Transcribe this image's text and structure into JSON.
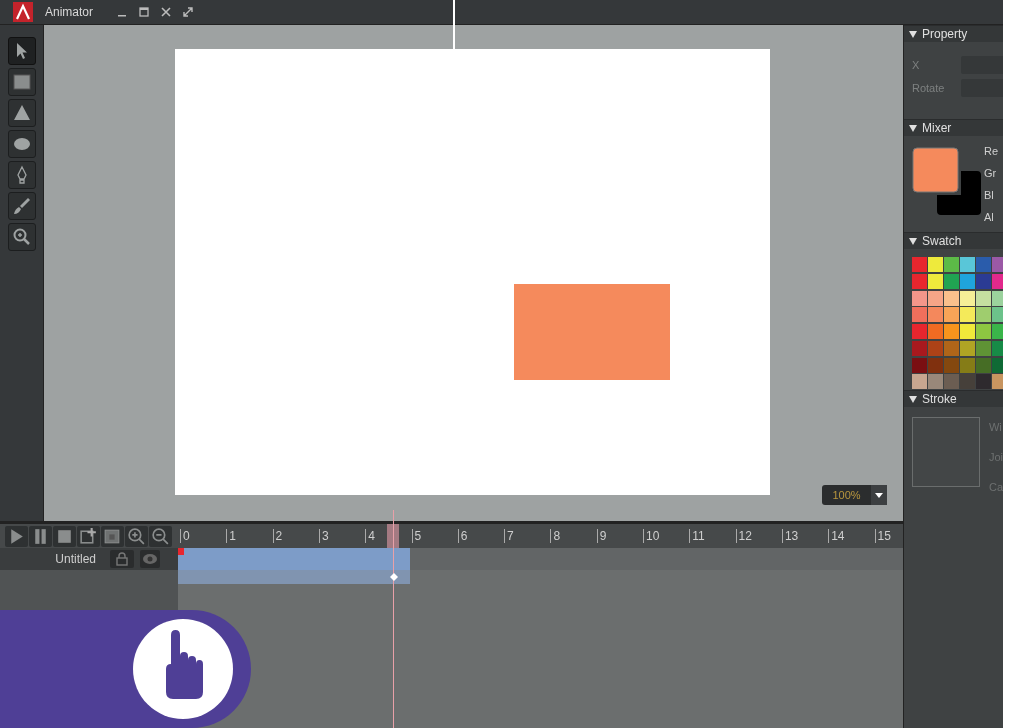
{
  "window": {
    "title": "Animator"
  },
  "tools": [
    {
      "kind": "select",
      "selected": true
    },
    {
      "kind": "rectangle",
      "selected": false
    },
    {
      "kind": "triangle",
      "selected": false
    },
    {
      "kind": "ellipse",
      "selected": false
    },
    {
      "kind": "pen",
      "selected": false
    },
    {
      "kind": "brush",
      "selected": false
    },
    {
      "kind": "zoom",
      "selected": false
    }
  ],
  "stage": {
    "shapes": [
      {
        "kind": "rectangle",
        "color": "#f58a5c"
      }
    ]
  },
  "zoom": {
    "value": "100%"
  },
  "timeline": {
    "controls": [
      {
        "kind": "play"
      },
      {
        "kind": "pause"
      },
      {
        "kind": "stop"
      },
      {
        "kind": "add-layer"
      },
      {
        "kind": "layer"
      },
      {
        "kind": "zoom-in"
      },
      {
        "kind": "zoom-out"
      }
    ],
    "ticks": [
      "0",
      "1",
      "2",
      "3",
      "4",
      "5",
      "6",
      "7",
      "8",
      "9",
      "10",
      "11",
      "12",
      "13",
      "14",
      "15"
    ],
    "layers": [
      {
        "name": "Untitled",
        "locked": false,
        "visible": true
      }
    ]
  },
  "property": {
    "title": "Property",
    "fields": [
      {
        "label": "X"
      },
      {
        "label": "Rotate"
      }
    ]
  },
  "mixer": {
    "title": "Mixer",
    "wells": [
      {
        "kind": "fill",
        "color": "#f58a5c"
      },
      {
        "kind": "stroke",
        "color": "#000000"
      }
    ],
    "labels": [
      "Re",
      "Gr",
      "Bl",
      "Al"
    ]
  },
  "swatch": {
    "title": "Swatch",
    "colors": [
      {
        "color": "#e8262e"
      },
      {
        "color": "#eeea3c"
      },
      {
        "color": "#5cba47"
      },
      {
        "color": "#59c6d8"
      },
      {
        "color": "#2a5cab"
      },
      {
        "color": "#9b59a6"
      },
      {
        "color": "#e8262e"
      },
      {
        "color": "#eeea3c"
      },
      {
        "color": "#20a452"
      },
      {
        "color": "#1fa4dc"
      },
      {
        "color": "#2b3b94"
      },
      {
        "color": "#e2298c"
      },
      {
        "color": "#f4968a"
      },
      {
        "color": "#f6a587"
      },
      {
        "color": "#f9c08c"
      },
      {
        "color": "#f6ef97"
      },
      {
        "color": "#c5dfa0"
      },
      {
        "color": "#9bd29d"
      },
      {
        "color": "#f06f5c"
      },
      {
        "color": "#f4885c"
      },
      {
        "color": "#f8a457"
      },
      {
        "color": "#f4ea5a"
      },
      {
        "color": "#9fcd6e"
      },
      {
        "color": "#6cc28a"
      },
      {
        "color": "#e8262e"
      },
      {
        "color": "#f06b22"
      },
      {
        "color": "#f7941d"
      },
      {
        "color": "#f0e93a"
      },
      {
        "color": "#8dc641"
      },
      {
        "color": "#3ab54a"
      },
      {
        "color": "#a8191e"
      },
      {
        "color": "#ad4217"
      },
      {
        "color": "#b06519"
      },
      {
        "color": "#b0a424"
      },
      {
        "color": "#5f9335"
      },
      {
        "color": "#178b47"
      },
      {
        "color": "#7a0f12"
      },
      {
        "color": "#80300e"
      },
      {
        "color": "#84480f"
      },
      {
        "color": "#857c17"
      },
      {
        "color": "#466d25"
      },
      {
        "color": "#0f6a35"
      },
      {
        "color": "#c7a690"
      },
      {
        "color": "#99887a"
      },
      {
        "color": "#6b5d52"
      },
      {
        "color": "#46403a"
      },
      {
        "color": "#2e2a2e"
      },
      {
        "color": "#c89560"
      }
    ]
  },
  "stroke": {
    "title": "Stroke",
    "labels": [
      "Wi",
      "Joi",
      "Ca"
    ]
  }
}
